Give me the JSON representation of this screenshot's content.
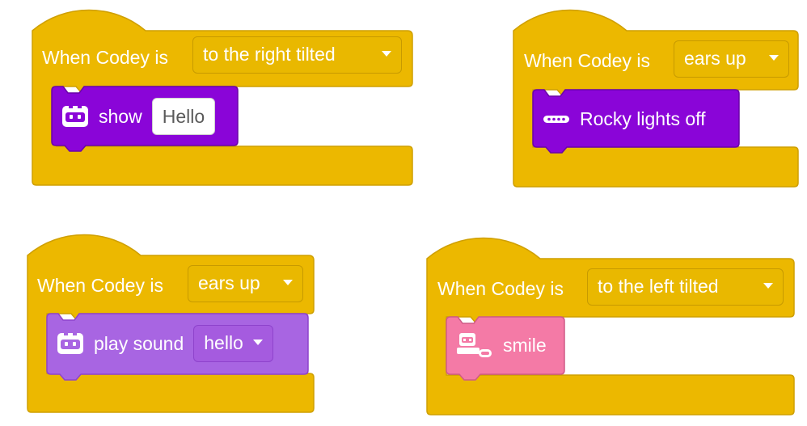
{
  "colors": {
    "event_block": "#ecb800",
    "event_border": "#cf9f00",
    "codey_block": "#8a05d8",
    "codey_block_border": "#6a04a7",
    "sound_block": "#a865e2",
    "sound_block_border": "#8e43cc",
    "face_block": "#f47aa6",
    "face_block_border": "#cf5a86"
  },
  "scripts": [
    {
      "hat_label": "When Codey is",
      "dropdown_value": "to the right tilted",
      "inner": {
        "icon": "codey-face-icon",
        "label": "show",
        "input_value": "Hello"
      }
    },
    {
      "hat_label": "When Codey is",
      "dropdown_value": "ears up",
      "inner": {
        "icon": "rocky-light-strip-icon",
        "label": "Rocky lights off"
      }
    },
    {
      "hat_label": "When Codey is",
      "dropdown_value": "ears up",
      "inner": {
        "icon": "codey-face-icon",
        "label": "play sound",
        "dropdown_value": "hello"
      }
    },
    {
      "hat_label": "When Codey is",
      "dropdown_value": "to the left tilted",
      "inner": {
        "icon": "codey-rocky-icon",
        "label": "smile"
      }
    }
  ]
}
